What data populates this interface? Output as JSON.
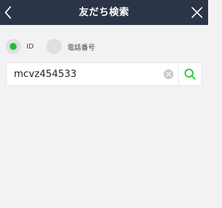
{
  "header": {
    "title": "友だち検索",
    "background": "#2c3447",
    "back_icon": "chevron-left-icon",
    "close_icon": "close-icon"
  },
  "search_type": {
    "options": [
      {
        "label": "ID",
        "selected": true
      },
      {
        "label": "電話番号",
        "selected": false
      }
    ],
    "selected_color": "#1fc12b"
  },
  "search": {
    "value": "mcvz454533",
    "clear_icon": "clear-icon",
    "search_icon": "search-icon",
    "search_icon_color": "#1fc12b"
  }
}
